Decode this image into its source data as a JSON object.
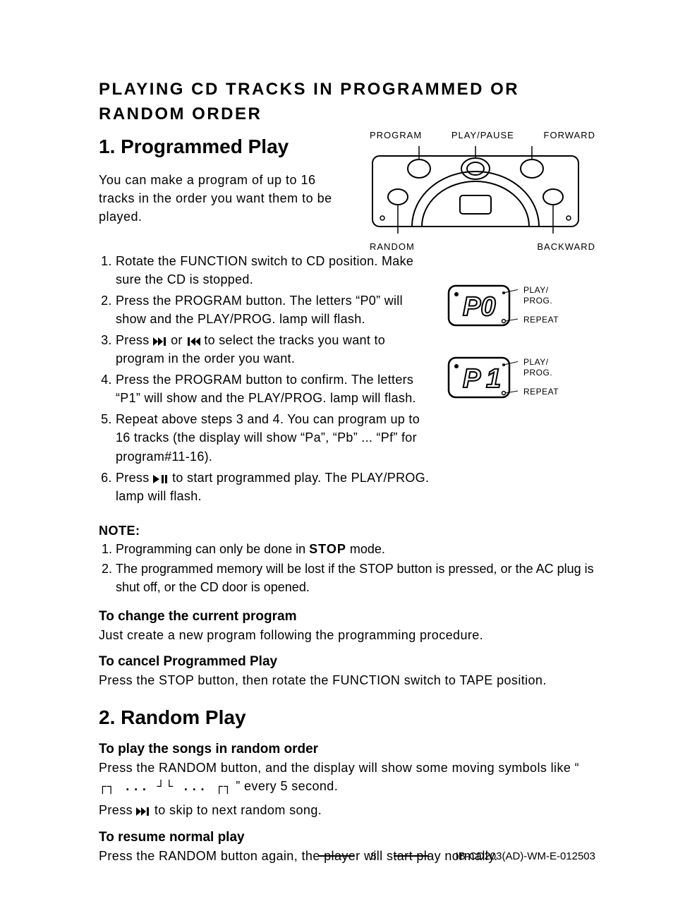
{
  "title": "PLAYING CD TRACKS IN PROGRAMMED OR RANDOM ORDER",
  "section1": {
    "heading": "1. Programmed Play",
    "intro": "You can make a program of up to 16 tracks in the order you want them to be played.",
    "panel_labels": {
      "program": "PROGRAM",
      "play_pause": "PLAY/PAUSE",
      "forward": "FORWARD",
      "random": "RANDOM",
      "backward": "BACKWARD"
    },
    "steps": [
      "Rotate the FUNCTION switch to CD position. Make sure the CD is stopped.",
      "Press the PROGRAM button. The letters “P0” will show and the PLAY/PROG. lamp will flash.",
      {
        "pre": "Press ",
        "post": " to select the tracks you want to program in the order you want.",
        "mid": " or "
      },
      "Press the PROGRAM button to confirm. The letters “P1” will show and the PLAY/PROG. lamp will flash.",
      "Repeat above steps 3 and 4. You can program up to 16 tracks (the display will show “Pa”, “Pb” ... “Pf” for program#11-16).",
      {
        "pre": "Press ",
        "post": " to start programmed play. The PLAY/PROG. lamp will flash."
      }
    ],
    "lcd": [
      {
        "text": "P0",
        "play_prog": "PLAY/\nPROG.",
        "repeat": "REPEAT"
      },
      {
        "text": "P 1",
        "play_prog": "PLAY/\nPROG.",
        "repeat": "REPEAT"
      }
    ],
    "note_heading": "NOTE:",
    "notes": [
      {
        "pre": "Programming can only be done in ",
        "stop": "STOP",
        "post": " mode."
      },
      "The programmed memory will be lost if the STOP button is pressed, or the AC plug is shut off, or the CD door is opened."
    ],
    "change_heading": "To change the current program",
    "change_text": "Just create a new program following the programming procedure.",
    "cancel_heading": "To cancel Programmed Play",
    "cancel_text": "Press the STOP button, then rotate the FUNCTION switch to TAPE position."
  },
  "section2": {
    "heading": "2. Random Play",
    "random_heading": "To play the songs in random order",
    "random_text_pre": "Press the RANDOM button, and the display will show some moving symbols like “ ",
    "random_syms": "┌┐ ... ┘└ ... ┌┐",
    "random_text_post": " ” every 5 second.",
    "skip_pre": "Press ",
    "skip_post": " to skip to next random song.",
    "resume_heading": "To resume normal play",
    "resume_text": "Press the RANDOM button again, the player will start play normally."
  },
  "footer": {
    "page": "8",
    "doc_id": "IB-CD203(AD)-WM-E-012503"
  }
}
